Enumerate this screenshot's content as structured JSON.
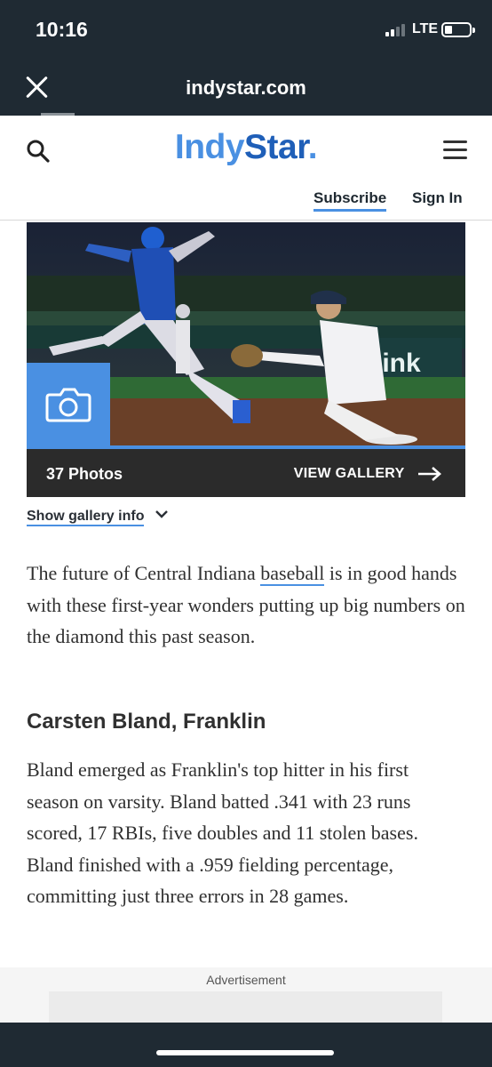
{
  "status_bar": {
    "time": "10:16",
    "network": "LTE"
  },
  "browser": {
    "url": "indystar.com",
    "close_icon": "close-icon"
  },
  "header": {
    "logo_part1": "Indy",
    "logo_part2": "Star",
    "logo_dot": ".",
    "subscribe": "Subscribe",
    "sign_in": "Sign In",
    "search_icon": "search-icon",
    "menu_icon": "hamburger-menu-icon"
  },
  "gallery": {
    "photo_count": "37 Photos",
    "view_label": "VIEW GALLERY",
    "info_label": "Show gallery info",
    "camera_icon": "camera-icon"
  },
  "article": {
    "intro_before_link": "The future of Central Indiana ",
    "intro_link": "baseball",
    "intro_after_link": " is in good hands with these first-year wonders putting up big numbers on the diamond this past season.",
    "subhead": "Carsten Bland, Franklin",
    "body": "Bland emerged as Franklin's top hitter in his first season on varsity. Bland batted .341 with 23 runs scored, 17 RBIs, five doubles and 11 stolen bases. Bland finished with a .959 fielding percentage, committing just three errors in 28 games."
  },
  "ad": {
    "label": "Advertisement"
  },
  "colors": {
    "chrome": "#1f2a33",
    "accent": "#4a90e2",
    "logo_dark": "#1f5fb8",
    "gallery_bar": "#2b2b2b"
  }
}
